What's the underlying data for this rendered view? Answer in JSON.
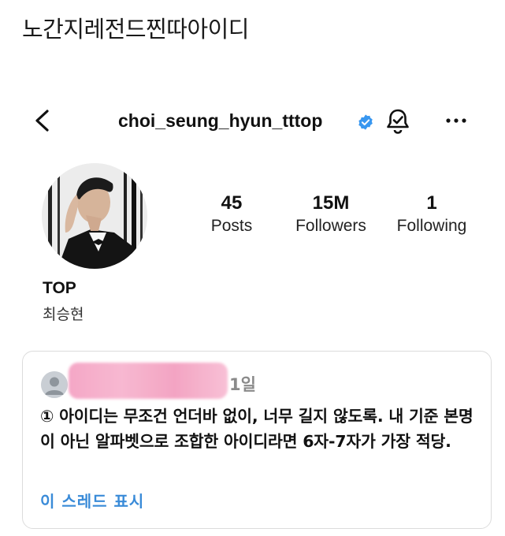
{
  "post_title": "노간지레전드찐따아이디",
  "profile": {
    "username": "choi_seung_hyun_tttop",
    "display_name": "TOP",
    "korean_name": "최승현",
    "stats": [
      {
        "value": "45",
        "label": "Posts"
      },
      {
        "value": "15M",
        "label": "Followers"
      },
      {
        "value": "1",
        "label": "Following"
      }
    ]
  },
  "icons": {
    "back": "chevron-left-icon",
    "verified": "verified-badge-icon",
    "bell": "notification-bell-icon",
    "more": "more-options-icon"
  },
  "comment": {
    "time": "1일",
    "text": "① 아이디는 무조건 언더바 없이, 너무 길지 않도록. 내 기준 본명이 아닌 알파벳으로 조합한 아이디라면 6자-7자가 가장 적당.",
    "thread_link": "이 스레드 표시"
  },
  "colors": {
    "verified": "#3897f0",
    "link": "#3a8bd8",
    "redaction": "#f5a3c4"
  }
}
